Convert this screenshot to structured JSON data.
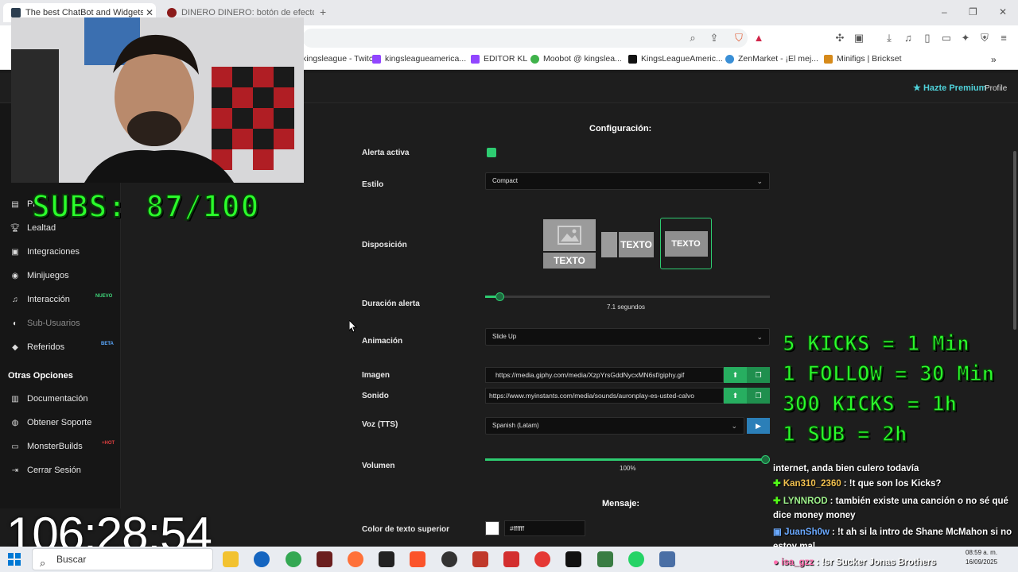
{
  "browser": {
    "tabs": [
      {
        "title": "The best ChatBot and Widgets f",
        "active": true,
        "favicon_color": "#2c3e50"
      },
      {
        "title": "DINERO DINERO: botón de efectos d",
        "active": false,
        "favicon_color": "#8b1a1a"
      }
    ],
    "new_tab": "+",
    "window_controls": {
      "minimize": "–",
      "restore": "❐",
      "close": "✕"
    },
    "bookmarks": [
      {
        "label": "kingsleague - Twitch",
        "icon_color": "#9146ff"
      },
      {
        "label": "kingsleagueamerica...",
        "icon_color": "#9146ff"
      },
      {
        "label": "EDITOR KL",
        "icon_color": "#9146ff"
      },
      {
        "label": "Moobot @ kingslea...",
        "icon_color": "#3fb24a"
      },
      {
        "label": "KingsLeagueAmeric...",
        "icon_color": "#111111"
      },
      {
        "label": "ZenMarket - ¡El mej...",
        "icon_color": "#3a8fd6"
      },
      {
        "label": "Minifigs | Brickset",
        "icon_color": "#d68a1a"
      }
    ]
  },
  "header": {
    "premium": "Hazte Premium",
    "profile": "Profile"
  },
  "sidebar": {
    "items": [
      {
        "label": "Pr",
        "icon": "list-icon",
        "dim": false
      },
      {
        "label": "Lealtad",
        "icon": "trophy-icon",
        "dim": false
      },
      {
        "label": "Integraciones",
        "icon": "plug-icon",
        "dim": false
      },
      {
        "label": "Minijuegos",
        "icon": "gamepad-icon",
        "dim": false
      },
      {
        "label": "Interacción",
        "icon": "music-icon",
        "dim": false,
        "tag": "NUEVO"
      },
      {
        "label": "Sub-Usuarios",
        "icon": "users-icon",
        "dim": true
      },
      {
        "label": "Referidos",
        "icon": "user-plus-icon",
        "dim": false,
        "tag": "BETA"
      }
    ],
    "other_title": "Otras Opciones",
    "other_items": [
      {
        "label": "Documentación",
        "icon": "doc-icon"
      },
      {
        "label": "Obtener Soporte",
        "icon": "support-icon"
      },
      {
        "label": "MonsterBuilds",
        "icon": "monitor-icon",
        "tag": "+HOT"
      },
      {
        "label": "Cerrar Sesión",
        "icon": "logout-icon"
      }
    ]
  },
  "config": {
    "title": "Configuración:",
    "alert_active_label": "Alerta activa",
    "style_label": "Estilo",
    "style_value": "Compact",
    "layout_label": "Disposición",
    "layout_text": "TEXTO",
    "duration_label": "Duración alerta",
    "duration_value": "7.1 segundos",
    "duration_fraction": 0.05,
    "animation_label": "Animación",
    "animation_value": "Slide Up",
    "image_label": "Imagen",
    "image_url": "https://media.giphy.com/media/XzpYrsGddNycxMN6sf/giphy.gif",
    "sound_label": "Sonido",
    "sound_url": "https://www.myinstants.com/media/sounds/auronplay-es-usted-calvo",
    "voice_label": "Voz (TTS)",
    "voice_value": "Spanish (Latam)",
    "volume_label": "Volumen",
    "volume_value": "100%",
    "volume_fraction": 1.0,
    "message_title": "Mensaje:",
    "top_text_color_label": "Color de texto superior",
    "top_text_color": "#ffffff"
  },
  "overlay": {
    "subs": "SUBS: 87/100",
    "rules": [
      "5 KICKS = 1 Min",
      "1 FOLLOW = 30 Min",
      "300 KICKS = 1h",
      "1 SUB = 2h"
    ],
    "timer": "106:28:54",
    "chat": [
      {
        "user": "",
        "text": "internet, anda bien culero todavía",
        "color": "#ffffff"
      },
      {
        "user": "Kan310_2360",
        "text": ": !t que son los Kicks?",
        "color": "#f2c14e"
      },
      {
        "user": "LYNNROD",
        "text": ": también existe una canción o no sé qué",
        "color": "#9df08a"
      },
      {
        "user": "",
        "text": "dice money money",
        "color": "#ffffff"
      },
      {
        "user": "JuanSh0w",
        "text": ": !t ah si la intro de Shane McMahon si no",
        "color": "#6aa9ff"
      },
      {
        "user": "",
        "text": "estoy mal",
        "color": "#ffffff"
      },
      {
        "user": "isa_gzz",
        "text": ": !sr Sucker Jonas Brothers",
        "color": "#ff6fae"
      }
    ]
  },
  "taskbar": {
    "search": "Buscar",
    "time": "08:59 a. m.",
    "date": "16/09/2025"
  }
}
